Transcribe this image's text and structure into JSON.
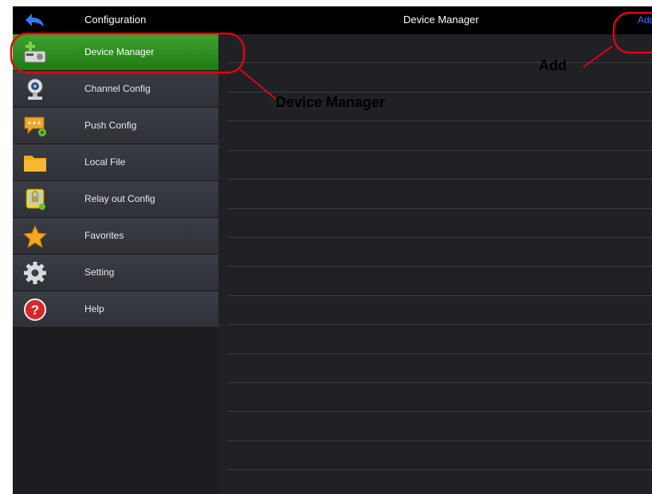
{
  "top_bar": {
    "left_title": "Configuration",
    "center_title": "Device Manager",
    "add_label": "Add"
  },
  "sidebar": {
    "items": [
      {
        "label": "Device Manager",
        "icon": "device-add-icon",
        "active": true
      },
      {
        "label": "Channel Config",
        "icon": "webcam-icon",
        "active": false
      },
      {
        "label": "Push Config",
        "icon": "message-gear-icon",
        "active": false
      },
      {
        "label": "Local File",
        "icon": "folder-icon",
        "active": false
      },
      {
        "label": "Relay out Config",
        "icon": "relay-lock-icon",
        "active": false
      },
      {
        "label": "Favorites",
        "icon": "star-icon",
        "active": false
      },
      {
        "label": "Setting",
        "icon": "gear-icon",
        "active": false
      },
      {
        "label": "Help",
        "icon": "help-icon",
        "active": false
      }
    ]
  },
  "annotations": {
    "device_manager": "Device Manager",
    "add": "Add"
  },
  "colors": {
    "accent_green": "#2f8f21",
    "annotation_red": "#e3000f",
    "link_blue": "#2f7cf6"
  }
}
